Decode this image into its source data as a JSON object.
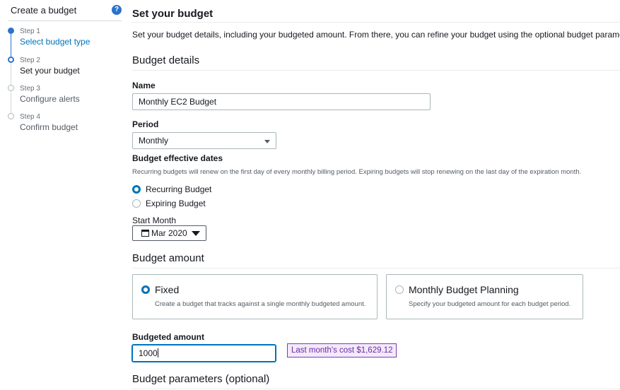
{
  "sidebar": {
    "title": "Create a budget",
    "help_icon": "help-circle-icon",
    "steps": [
      {
        "num": "Step 1",
        "label": "Select budget type",
        "state": "done"
      },
      {
        "num": "Step 2",
        "label": "Set your budget",
        "state": "current"
      },
      {
        "num": "Step 3",
        "label": "Configure alerts",
        "state": "pending"
      },
      {
        "num": "Step 4",
        "label": "Confirm budget",
        "state": "pending"
      }
    ]
  },
  "main": {
    "title": "Set your budget",
    "intro": "Set your budget details, including your budgeted amount. From there, you can refine your budget using the optional budget parameters.",
    "details": {
      "heading": "Budget details",
      "name_label": "Name",
      "name_value": "Monthly EC2 Budget",
      "period_label": "Period",
      "period_value": "Monthly",
      "dates_label": "Budget effective dates",
      "dates_hint": "Recurring budgets will renew on the first day of every monthly billing period. Expiring budgets will stop renewing on the last day of the expiration month.",
      "recurring_label": "Recurring Budget",
      "expiring_label": "Expiring Budget",
      "selected_type": "Recurring Budget",
      "start_month_label": "Start Month",
      "start_month_value": "Mar 2020"
    },
    "amount": {
      "heading": "Budget amount",
      "fixed_title": "Fixed",
      "fixed_desc": "Create a budget that tracks against a single monthly budgeted amount.",
      "planning_title": "Monthly Budget Planning",
      "planning_desc": "Specify your budgeted amount for each budget period.",
      "selected_option": "Fixed",
      "budgeted_label": "Budgeted amount",
      "budgeted_value": "1000",
      "last_month_cost": "Last month's cost $1,629.12"
    },
    "parameters": {
      "heading": "Budget parameters (optional)"
    }
  },
  "colors": {
    "accent": "#0073bb",
    "step_active": "#2c73c9",
    "badge_border": "#7d3ab9",
    "badge_bg": "#f3eaf9"
  }
}
